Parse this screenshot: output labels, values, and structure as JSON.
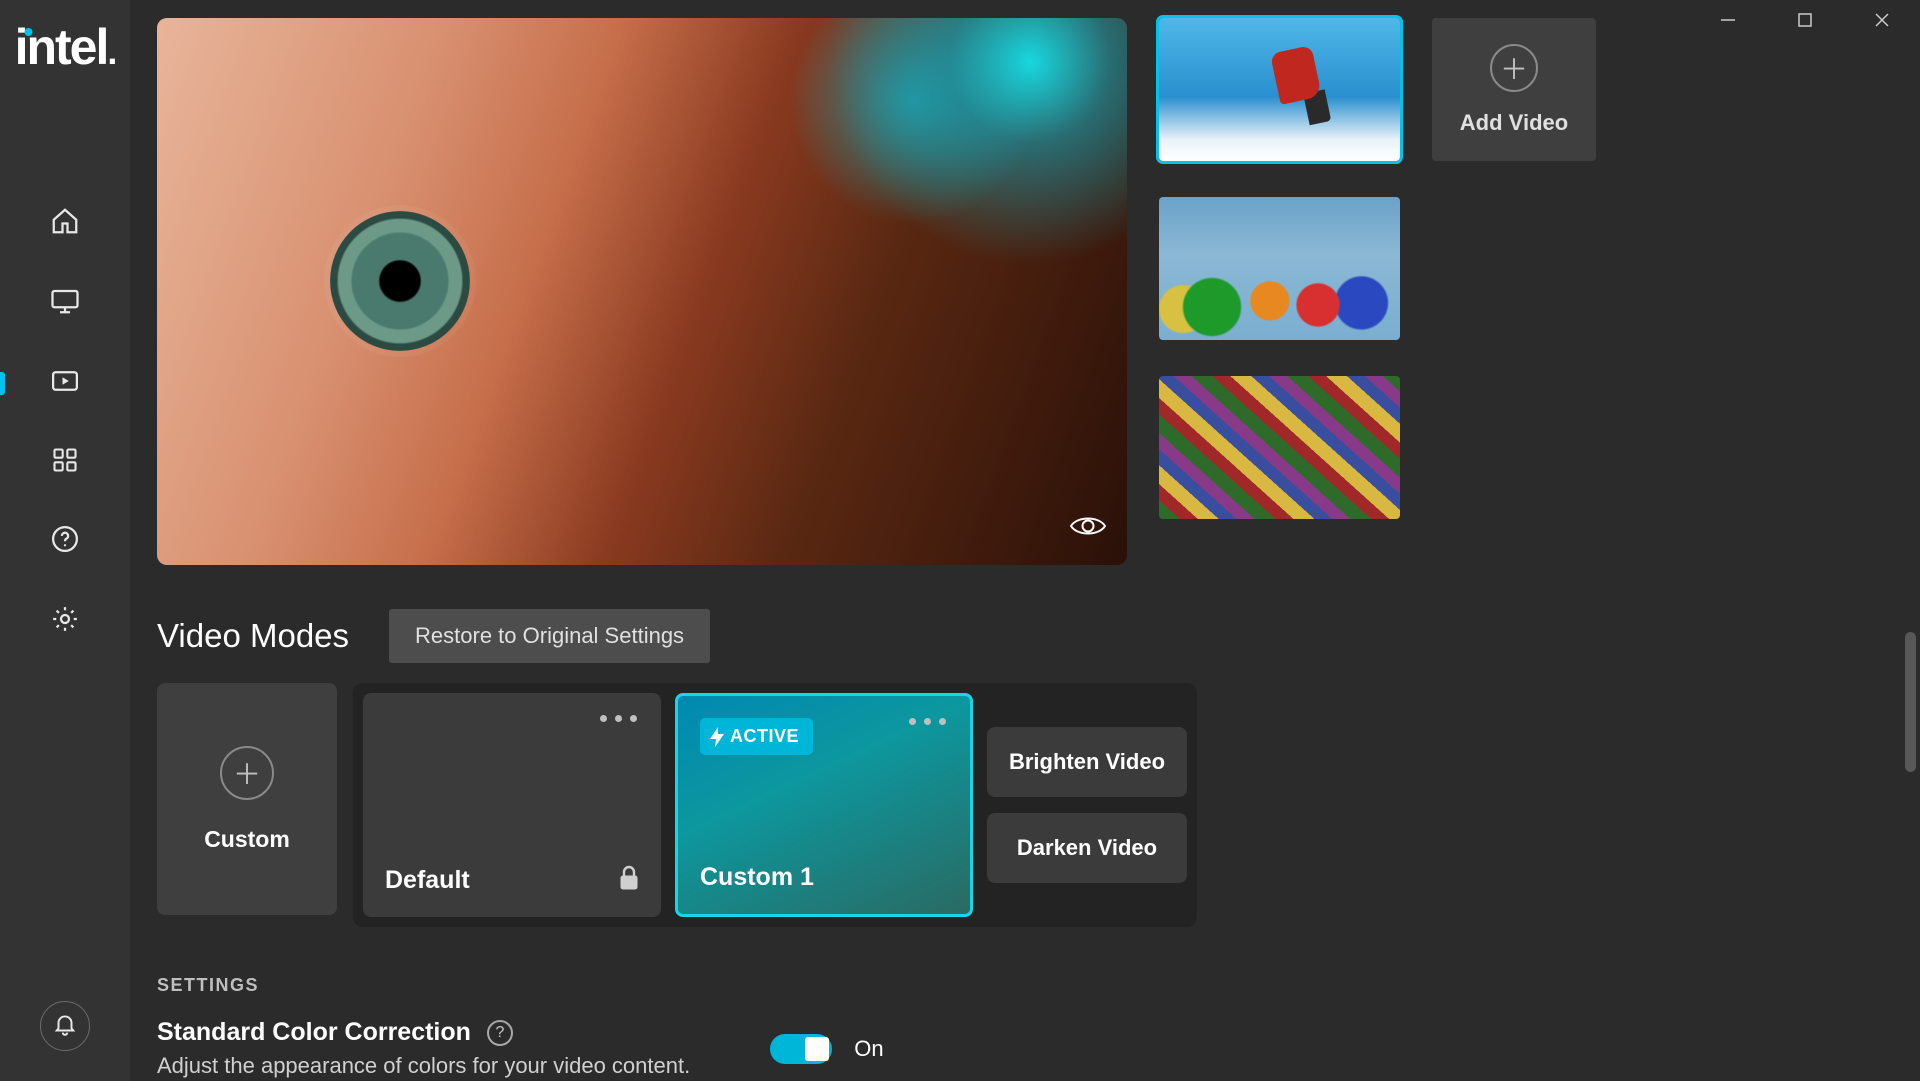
{
  "brand": "intel",
  "window": {
    "minimize": "—",
    "maximize": "☐",
    "close": "✕"
  },
  "sidebar": {
    "items": [
      {
        "name": "home"
      },
      {
        "name": "display"
      },
      {
        "name": "video",
        "active": true
      },
      {
        "name": "apps"
      },
      {
        "name": "help"
      },
      {
        "name": "settings"
      }
    ],
    "notification": "bell"
  },
  "add_video_label": "Add Video",
  "modes": {
    "title": "Video Modes",
    "restore": "Restore to Original Settings",
    "add_label": "Custom",
    "default_label": "Default",
    "active_badge": "ACTIVE",
    "custom1_label": "Custom 1",
    "brighten": "Brighten Video",
    "darken": "Darken Video"
  },
  "settings": {
    "heading": "SETTINGS",
    "color_correction": {
      "title": "Standard Color Correction",
      "desc": "Adjust the appearance of colors for your video content.",
      "help": "?",
      "state": "On",
      "value": true
    }
  },
  "colors": {
    "accent": "#00c2f0"
  }
}
